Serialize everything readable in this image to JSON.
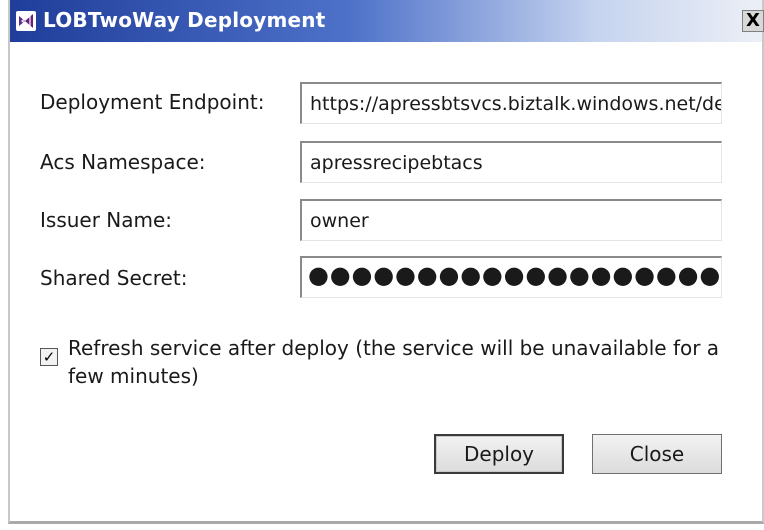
{
  "window": {
    "title": "LOBTwoWay Deployment",
    "close_glyph": "X"
  },
  "form": {
    "deployment_endpoint": {
      "label": "Deployment Endpoint:",
      "value": "https://apressbtsvcs.biztalk.windows.net/def"
    },
    "acs_namespace": {
      "label": "Acs Namespace:",
      "value": "apressrecipebtacs"
    },
    "issuer_name": {
      "label": "Issuer Name:",
      "value": "owner"
    },
    "shared_secret": {
      "label": "Shared Secret:",
      "value": "●●●●●●●●●●●●●●●●●●●●●●●●●●●●●●●●●●"
    }
  },
  "refresh_option": {
    "checked": true,
    "check_glyph": "✓",
    "label": "Refresh service after deploy (the service will be unavailable for a few minutes)"
  },
  "buttons": {
    "deploy": "Deploy",
    "close": "Close"
  },
  "icons": {
    "app": "visual-studio-icon",
    "close": "close-icon"
  }
}
